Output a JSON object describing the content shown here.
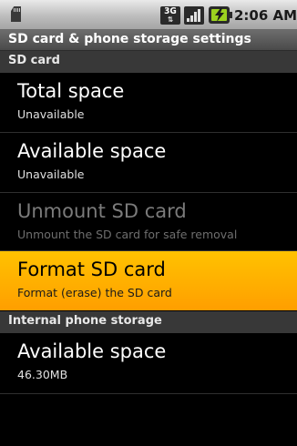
{
  "status_bar": {
    "network_type": "3G",
    "time": "2:06 AM",
    "icons": [
      "sd-card-icon",
      "3g-icon",
      "signal-icon",
      "battery-charging-icon"
    ]
  },
  "title_bar": {
    "title": "SD card & phone storage settings"
  },
  "sections": [
    {
      "header": "SD card",
      "items": [
        {
          "title": "Total space",
          "summary": "Unavailable",
          "enabled": true
        },
        {
          "title": "Available space",
          "summary": "Unavailable",
          "enabled": true
        },
        {
          "title": "Unmount SD card",
          "summary": "Unmount the SD card for safe removal",
          "enabled": false
        },
        {
          "title": "Format SD card",
          "summary": "Format (erase) the SD card",
          "enabled": true,
          "highlighted": true
        }
      ]
    },
    {
      "header": "Internal phone storage",
      "items": [
        {
          "title": "Available space",
          "summary": "46.30MB",
          "enabled": true
        }
      ]
    }
  ],
  "colors": {
    "highlight": "#ffad00",
    "background": "#000000",
    "section_header": "#383838"
  }
}
